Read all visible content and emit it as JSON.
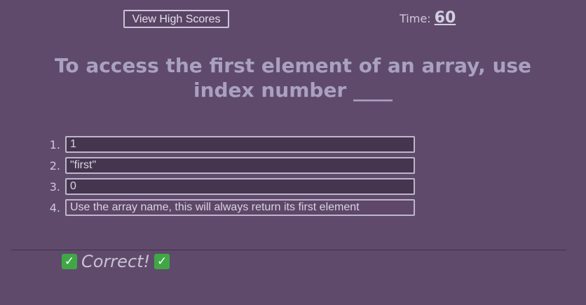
{
  "header": {
    "high_scores_label": "View High Scores",
    "timer_label": "Time:",
    "timer_value": "60"
  },
  "question": {
    "text": "To access the first element of an array, use index number ____"
  },
  "answers": [
    {
      "number": "1.",
      "label": "1"
    },
    {
      "number": "2.",
      "label": "\"first\""
    },
    {
      "number": "3.",
      "label": "0"
    },
    {
      "number": "4.",
      "label": "Use the array name, this will always return its first element"
    }
  ],
  "feedback": {
    "text": "Correct!",
    "icon": "check-mark-icon",
    "icon_glyph": "✓",
    "icon_color": "#3fa845"
  },
  "colors": {
    "background": "#604a6c",
    "question_text": "#a9a1bf",
    "answer_button": "#46354f"
  }
}
